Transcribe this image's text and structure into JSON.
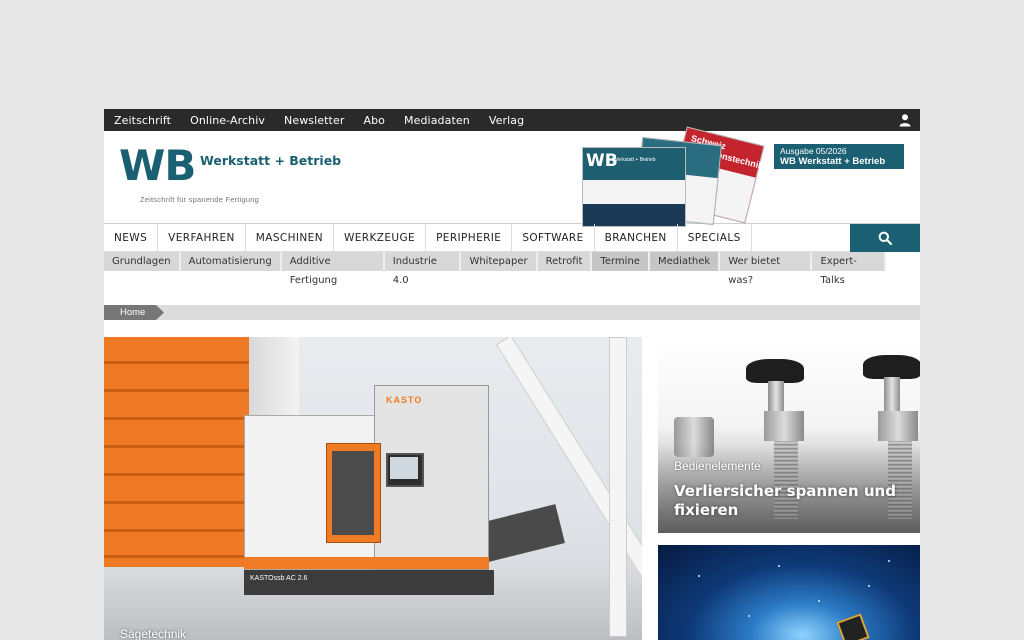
{
  "topnav": [
    "Zeitschrift",
    "Online-Archiv",
    "Newsletter",
    "Abo",
    "Mediadaten",
    "Verlag"
  ],
  "logo": {
    "initials": "WB",
    "name": "Werkstatt + Betrieb",
    "tagline": "Zeitschrift für spanende Fertigung"
  },
  "issue": {
    "line1": "Ausgabe 05/2026",
    "line2": "WB Werkstatt + Betrieb"
  },
  "cover_texts": {
    "wb": "WB",
    "small": "Werkstatt + Betrieb",
    "cover3": "Schweiz Präzisionstechnik"
  },
  "mainnav": [
    "NEWS",
    "VERFAHREN",
    "MASCHINEN",
    "WERKZEUGE",
    "PERIPHERIE",
    "SOFTWARE",
    "BRANCHEN",
    "SPECIALS"
  ],
  "subnav": [
    "Grundlagen",
    "Automatisierung",
    "Additive Fertigung",
    "Industrie 4.0",
    "Whitepaper",
    "Retrofit",
    "Termine",
    "Mediathek",
    "Wer bietet was?",
    "Expert-Talks"
  ],
  "breadcrumb": {
    "home": "Home"
  },
  "hero": {
    "category": "Sägetechnik",
    "machine_logo": "KASTO",
    "machine_label": "KASTOssb AC 2.6"
  },
  "teaser1": {
    "category": "Bedienelemente",
    "title": "Verliersicher spannen und fixieren"
  },
  "colors": {
    "brand": "#1a5f72",
    "topbar": "#2a2a2a",
    "accent_orange": "#ef7c24"
  }
}
